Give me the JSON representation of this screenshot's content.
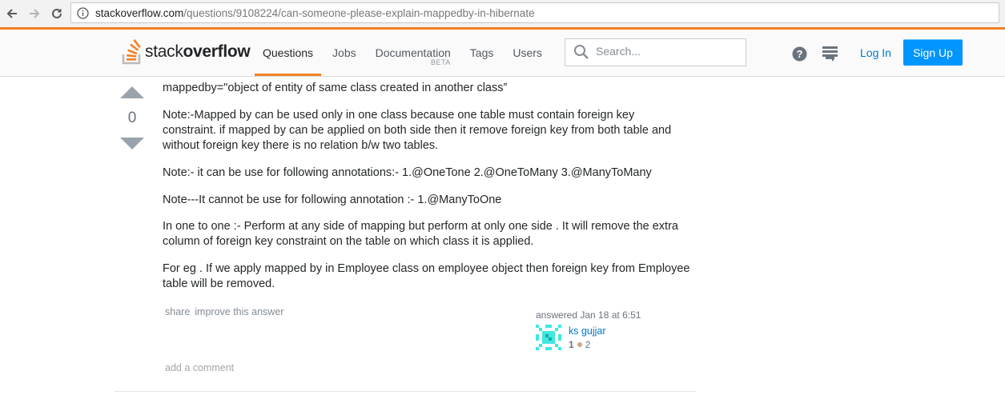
{
  "browser": {
    "url_host": "stackoverflow.com",
    "url_path": "/questions/9108224/can-someone-please-explain-mappedby-in-hibernate"
  },
  "header": {
    "logo_text_light": "stack",
    "logo_text_bold": "overflow",
    "nav": [
      {
        "label": "Questions",
        "active": true
      },
      {
        "label": "Jobs"
      },
      {
        "label": "Documentation",
        "badge": "BETA"
      },
      {
        "label": "Tags"
      },
      {
        "label": "Users"
      }
    ],
    "search_placeholder": "Search...",
    "login_label": "Log In",
    "signup_label": "Sign Up",
    "accent_color": "#f48024",
    "button_color": "#0095ff"
  },
  "answer": {
    "vote_count": "0",
    "paragraphs": [
      "mappedby=\"object of entity of same class created in another class”",
      "Note:-Mapped by can be used only in one class because one table must contain foreign key constraint. if mapped by can be applied on both side then it remove foreign key from both table and without foreign key there is no relation b/w two tables.",
      "Note:- it can be use for following annotations:- 1.@OneTone 2.@OneToMany 3.@ManyToMany",
      "Note---It cannot be use for following annotation :- 1.@ManyToOne",
      "In one to one :- Perform at any side of mapping but perform at only one side . It will remove the extra column of foreign key constraint on the table on which class it is applied.",
      "For eg . If we apply mapped by in Employee class on employee object then foreign key from Employee table will be removed."
    ],
    "menu": {
      "share": "share",
      "improve": "improve this answer"
    },
    "answered": "answered Jan 18 at 6:51",
    "user": {
      "name": "ks gujjar",
      "reputation": "1",
      "bronze_badges": "2"
    },
    "add_comment": "add a comment"
  }
}
